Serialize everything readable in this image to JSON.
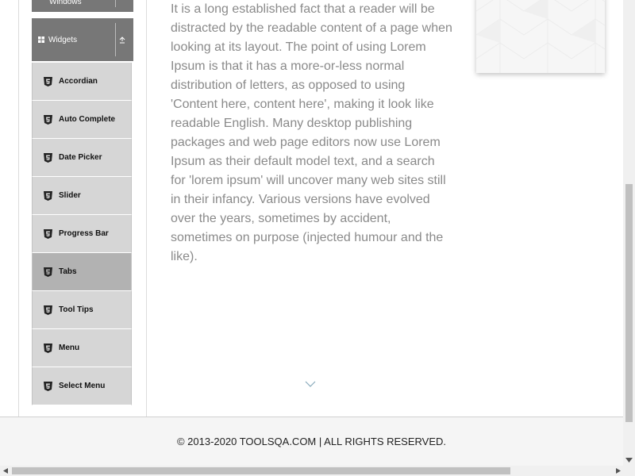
{
  "sidebar": {
    "windows_label": "Windows",
    "widgets_label": "Widgets",
    "items": [
      {
        "label": "Accordian",
        "icon": "html5-icon"
      },
      {
        "label": "Auto Complete",
        "icon": "html5-icon"
      },
      {
        "label": "Date Picker",
        "icon": "html5-icon"
      },
      {
        "label": "Slider",
        "icon": "html5-icon"
      },
      {
        "label": "Progress Bar",
        "icon": "html5-icon"
      },
      {
        "label": "Tabs",
        "icon": "html5-icon",
        "active": true
      },
      {
        "label": "Tool Tips",
        "icon": "html5-icon"
      },
      {
        "label": "Menu",
        "icon": "html5-icon"
      },
      {
        "label": "Select Menu",
        "icon": "html5-icon"
      }
    ]
  },
  "content": {
    "paragraph": "It is a long established fact that a reader will be distracted by the readable content of a page when looking at its layout. The point of using Lorem Ipsum is that it has a more-or-less normal distribution of letters, as opposed to using 'Content here, content here', making it look like readable English. Many desktop publishing packages and web page editors now use Lorem Ipsum as their default model text, and a search for 'lorem ipsum' will uncover many web sites still in their infancy. Various versions have evolved over the years, sometimes by accident, sometimes on purpose (injected humour and the like)."
  },
  "footer": {
    "text": "© 2013-2020 TOOLSQA.COM | ALL RIGHTS RESERVED."
  },
  "colors": {
    "group_header_bg": "#777777",
    "menu_item_bg": "#d6d6d6",
    "menu_item_active_bg": "#b2b2b2",
    "content_text": "#8a8a8a"
  }
}
